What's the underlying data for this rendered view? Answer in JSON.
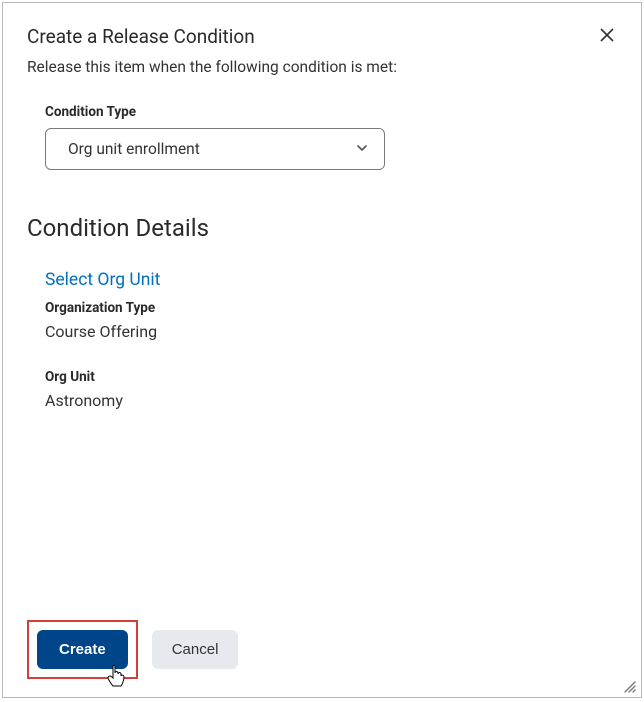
{
  "dialog": {
    "title": "Create a Release Condition",
    "subtitle": "Release this item when the following condition is met:"
  },
  "conditionType": {
    "label": "Condition Type",
    "selected": "Org unit enrollment"
  },
  "details": {
    "heading": "Condition Details",
    "linkHeading": "Select Org Unit",
    "orgTypeLabel": "Organization Type",
    "orgTypeValue": "Course Offering",
    "orgUnitLabel": "Org Unit",
    "orgUnitValue": "Astronomy"
  },
  "footer": {
    "create": "Create",
    "cancel": "Cancel"
  }
}
